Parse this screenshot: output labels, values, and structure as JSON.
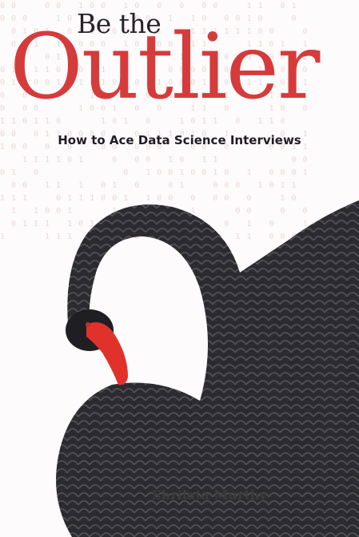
{
  "cover": {
    "title_top": "Be the",
    "title_main": "Outlier",
    "subtitle": "How to Ace Data Science Interviews",
    "author": "Shrilata Murthy"
  },
  "colors": {
    "accent": "#d63b3c",
    "text": "#27212a",
    "swan": "#2a2a2e",
    "beak": "#e0322b"
  }
}
